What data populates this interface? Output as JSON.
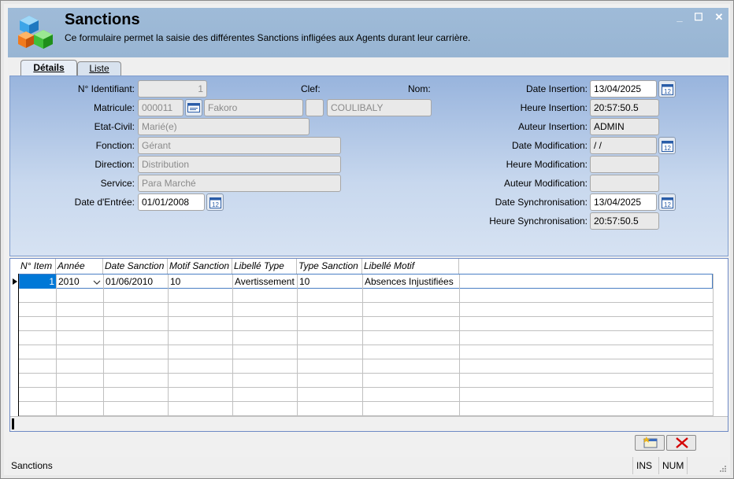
{
  "window": {
    "title": "Sanctions",
    "description": "Ce formulaire permet la saisie des différentes Sanctions infligées aux Agents durant leur carrière.",
    "controls": {
      "minimize": "_",
      "maximize": "☐",
      "close": "✕"
    }
  },
  "tabs": [
    {
      "label": "Détails",
      "active": true
    },
    {
      "label": "Liste",
      "active": false
    }
  ],
  "form": {
    "labels": {
      "identifiant": "N° Identifiant:",
      "clef": "Clef:",
      "nom": "Nom:",
      "matricule": "Matricule:",
      "etat_civil": "Etat-Civil:",
      "fonction": "Fonction:",
      "direction": "Direction:",
      "service": "Service:",
      "date_entree": "Date d'Entrée:",
      "date_insertion": "Date Insertion:",
      "heure_insertion": "Heure Insertion:",
      "auteur_insertion": "Auteur Insertion:",
      "date_modification": "Date Modification:",
      "heure_modification": "Heure Modification:",
      "auteur_modification": "Auteur Modification:",
      "date_synchronisation": "Date Synchronisation:",
      "heure_synchronisation": "Heure Synchronisation:"
    },
    "values": {
      "identifiant": "1",
      "matricule": "000011",
      "prenom": "Fakoro",
      "clef": "",
      "nom": "COULIBALY",
      "etat_civil": "Marié(e)",
      "fonction": "Gérant",
      "direction": "Distribution",
      "service": "Para Marché",
      "date_entree": "01/01/2008",
      "date_insertion": "13/04/2025",
      "heure_insertion": "20:57:50.5",
      "auteur_insertion": "ADMIN",
      "date_modification": " / /",
      "heure_modification": "",
      "auteur_modification": "",
      "date_synchronisation": "13/04/2025",
      "heure_synchronisation": "20:57:50.5"
    }
  },
  "grid": {
    "columns": [
      "N° Item",
      "Année",
      "Date Sanction",
      "Motif Sanction",
      "Libellé Type",
      "Type Sanction",
      "Libellé Motif"
    ],
    "rows": [
      {
        "item": "1",
        "annee": "2010",
        "date_sanction": "01/06/2010",
        "motif_sanction": "10",
        "libelle_type": "Avertissement",
        "type_sanction": "10",
        "libelle_motif": "Absences Injustifiées"
      }
    ]
  },
  "statusbar": {
    "text": "Sanctions",
    "ins": "INS",
    "num": "NUM"
  },
  "colors": {
    "title_bg": "#9fbbd8",
    "form_bg": "#c8d8ee",
    "grid_border": "#6d89c4",
    "selection": "#0078d7"
  }
}
